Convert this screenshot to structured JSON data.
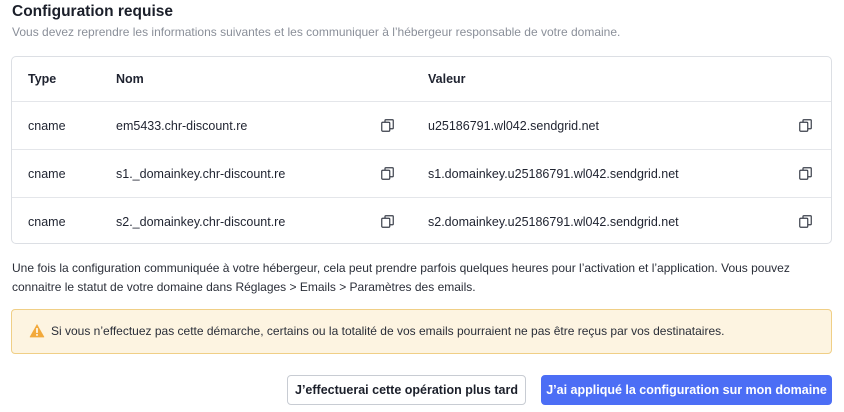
{
  "section": {
    "title": "Configuration requise",
    "subtitle": "Vous devez reprendre les informations suivantes et les communiquer à l’hébergeur responsable de votre domaine."
  },
  "table": {
    "headers": {
      "type": "Type",
      "name": "Nom",
      "value": "Valeur"
    },
    "rows": [
      {
        "type": "cname",
        "name": "em5433.chr-discount.re",
        "value": "u25186791.wl042.sendgrid.net"
      },
      {
        "type": "cname",
        "name": "s1._domainkey.chr-discount.re",
        "value": "s1.domainkey.u25186791.wl042.sendgrid.net"
      },
      {
        "type": "cname",
        "name": "s2._domainkey.chr-discount.re",
        "value": "s2.domainkey.u25186791.wl042.sendgrid.net"
      }
    ],
    "copy_icon": "copy-icon"
  },
  "info": {
    "text": "Une fois la configuration communiquée à votre hébergeur, cela peut prendre parfois quelques heures pour l’activation et l’application. Vous pouvez connaitre le statut de votre domaine dans Réglages > Emails > Paramètres des emails."
  },
  "warning": {
    "icon": "warning-icon",
    "text": "Si vous n’effectuez pas cette démarche, certains ou la totalité de vos emails pourraient ne pas être reçus par vos destinataires."
  },
  "actions": {
    "later_label": "J’effectuerai cette opération plus tard",
    "applied_label": "J’ai appliqué la configuration sur mon domaine"
  },
  "colors": {
    "primary": "#4c6ef5",
    "warning_bg": "#fdf4e1",
    "warning_border": "#f0cf86",
    "warning_icon": "#f2a93b"
  }
}
